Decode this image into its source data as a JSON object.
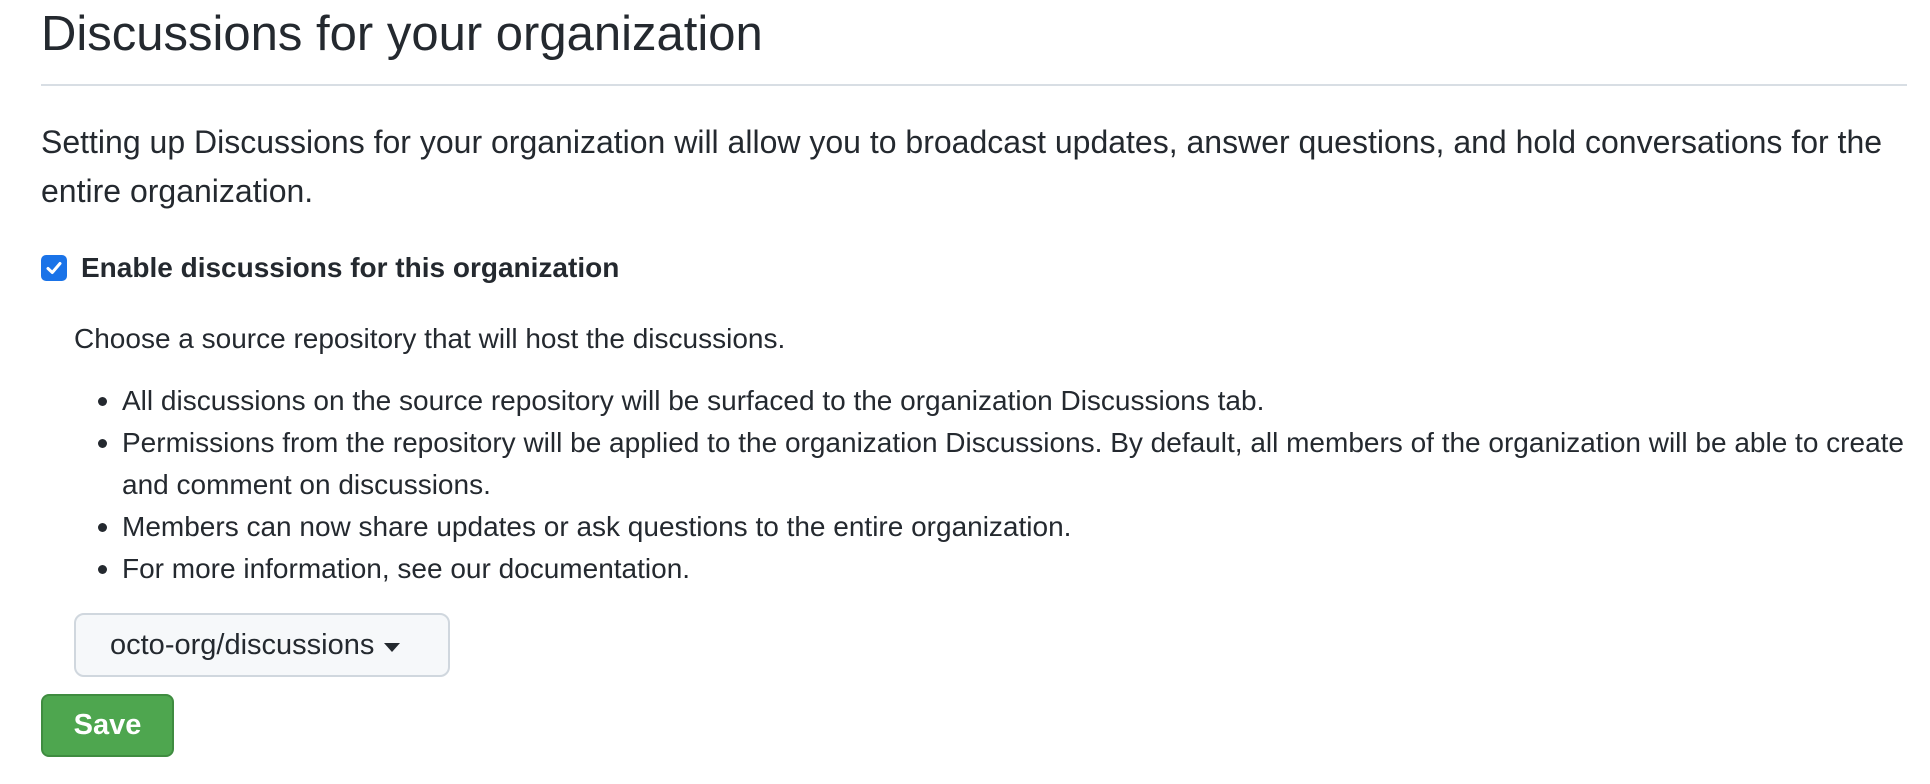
{
  "page_title": "Discussions for your organization",
  "intro_text": "Setting up Discussions for your organization will allow you to broadcast updates, answer questions, and hold conversations for the entire organization.",
  "enable_checkbox": {
    "checked": true,
    "label": "Enable discussions for this organization",
    "color": "#1a73e8"
  },
  "source_repo_prompt": "Choose a source repository that will host the discussions.",
  "bullets": [
    "All discussions on the source repository will be surfaced to the organization Discussions tab.",
    "Permissions from the repository will be applied to the organization Discussions. By default, all members of the organization will be able to create and comment on discussions.",
    "Members can now share updates or ask questions to the entire organization.",
    "For more information, see our documentation."
  ],
  "repo_select": {
    "selected": "octo-org/discussions",
    "icon": "caret-down-icon"
  },
  "save_button": {
    "label": "Save",
    "color": "#4ea64f"
  }
}
